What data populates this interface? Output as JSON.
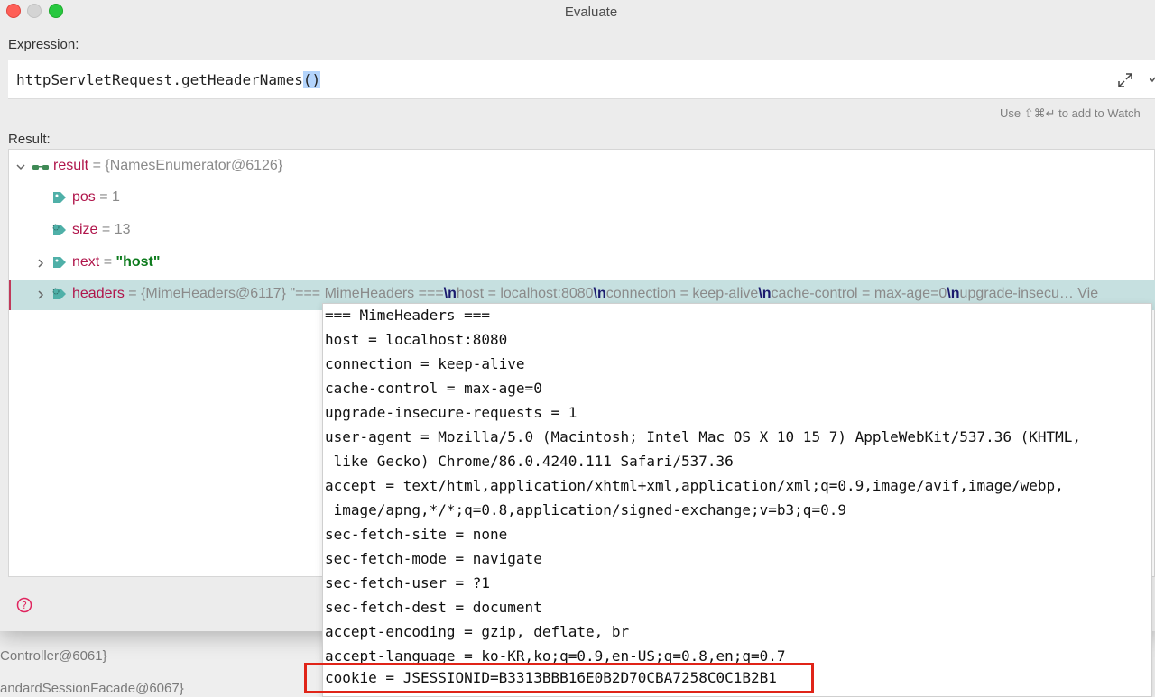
{
  "window": {
    "title": "Evaluate"
  },
  "expression": {
    "label": "Expression:",
    "text": "httpServletRequest.getHeaderNames",
    "paren": "()",
    "hint": "Use ⇧⌘↵ to add to Watch"
  },
  "result": {
    "label": "Result:",
    "rows": [
      {
        "name": "result",
        "eq": " = ",
        "value": "{NamesEnumerator@6126}",
        "icon": "glasses-icon",
        "expanded": true
      },
      {
        "name": "pos",
        "eq": " = ",
        "value": "1",
        "icon": "field-tag-icon"
      },
      {
        "name": "size",
        "eq": " = ",
        "value": "13",
        "icon": "field-tag-final-icon"
      },
      {
        "name": "next",
        "eq": " = ",
        "value": "\"host\"",
        "icon": "field-tag-icon",
        "collapsed": true
      },
      {
        "name": "headers",
        "eq": " = ",
        "value": "{MimeHeaders@6117} ",
        "icon": "field-tag-final-icon",
        "collapsed": true,
        "selected": true,
        "preview": [
          {
            "t": "\"=== MimeHeaders ==="
          },
          {
            "t": "\\n",
            "esc": true
          },
          {
            "t": "host = localhost:8080"
          },
          {
            "t": "\\n",
            "esc": true
          },
          {
            "t": "connection = keep-alive"
          },
          {
            "t": "\\n",
            "esc": true
          },
          {
            "t": "cache-control = max-age=0"
          },
          {
            "t": "\\n",
            "esc": true
          },
          {
            "t": "upgrade-insecu… Vie"
          }
        ]
      }
    ]
  },
  "popup": {
    "lines": [
      "=== MimeHeaders ===",
      "host = localhost:8080",
      "connection = keep-alive",
      "cache-control = max-age=0",
      "upgrade-insecure-requests = 1",
      "user-agent = Mozilla/5.0 (Macintosh; Intel Mac OS X 10_15_7) AppleWebKit/537.36 (KHTML,",
      " like Gecko) Chrome/86.0.4240.111 Safari/537.36",
      "accept = text/html,application/xhtml+xml,application/xml;q=0.9,image/avif,image/webp,",
      " image/apng,*/*;q=0.8,application/signed-exchange;v=b3;q=0.9",
      "sec-fetch-site = none",
      "sec-fetch-mode = navigate",
      "sec-fetch-user = ?1",
      "sec-fetch-dest = document",
      "accept-encoding = gzip, deflate, br",
      "accept-language = ko-KR,ko;q=0.9,en-US;q=0.8,en;q=0.7",
      "cookie = JSESSIONID=B3313BBB16E0B2D70CBA7258C0C1B2B1"
    ]
  },
  "background": {
    "lines": [
      "Controller@6061}",
      "andardSessionFacade@6067}"
    ]
  },
  "colors": {
    "var_name": "#b0154b",
    "string_value": "#0c7a1c",
    "selection": "#c6e0e0",
    "highlight_box": "#e02418"
  }
}
